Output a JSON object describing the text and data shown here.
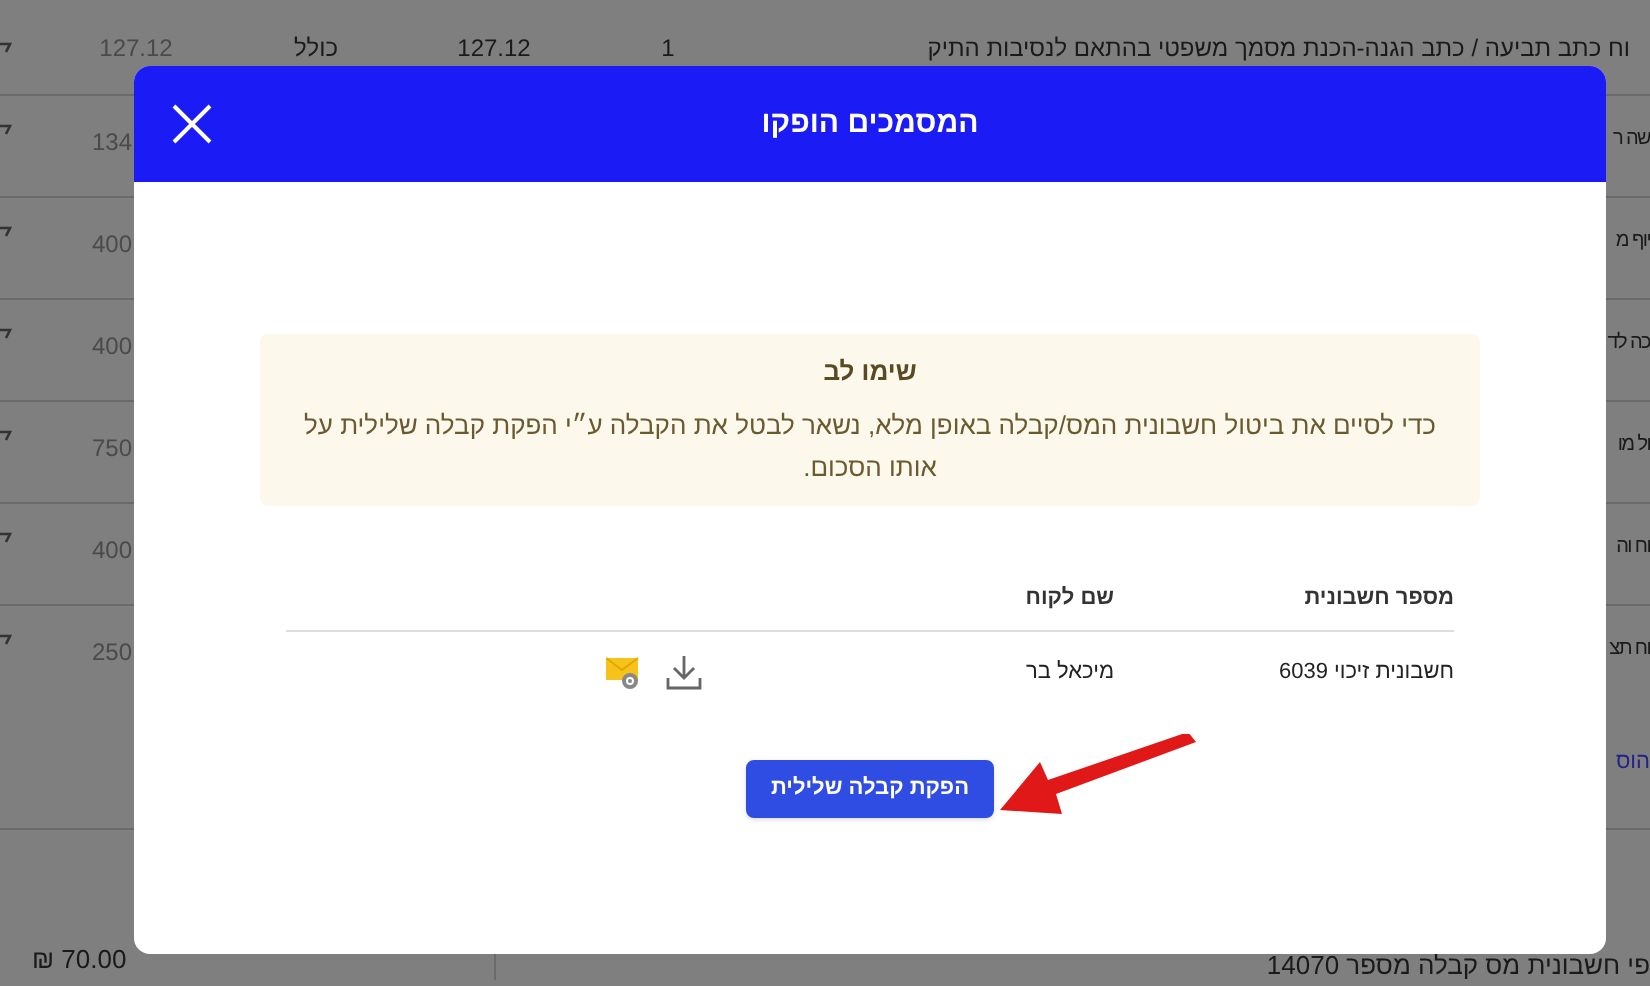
{
  "background_table": {
    "first_row": {
      "amount": "127.12",
      "vat": "כולל",
      "price": "127.12",
      "quantity": "1",
      "description": "וח כתב תביעה / כתב הגנה-הכנת מסמך משפטי בהתאם לנסיבות התיק"
    },
    "partial_rows": [
      {
        "amount": "134",
        "description": "שה ר"
      },
      {
        "amount": "400",
        "description": "יוף מ"
      },
      {
        "amount": "400",
        "description": "כה לד"
      },
      {
        "amount": "750",
        "description": "ול מו"
      },
      {
        "amount": "400",
        "description": "וח וה"
      },
      {
        "amount": "250",
        "description": "וח תצ"
      }
    ],
    "add_link": "הוס",
    "total_amount": "₪ 70.00",
    "footer_note": "פי חשבונית מס קבלה מספר 14070"
  },
  "dialog": {
    "title": "המסמכים הופקו",
    "notice": {
      "title": "שימו לב",
      "text": "כדי לסיים את ביטול חשבונית המס/קבלה באופן מלא, נשאר לבטל את הקבלה ע״י הפקת קבלה שלילית על אותו הסכום."
    },
    "table": {
      "columns": [
        "מספר חשבונית",
        "שם לקוח"
      ],
      "rows": [
        {
          "invoice": "חשבונית זיכוי 6039",
          "customer": "מיכאל בר"
        }
      ]
    },
    "button": "הפקת קבלה שלילית"
  }
}
